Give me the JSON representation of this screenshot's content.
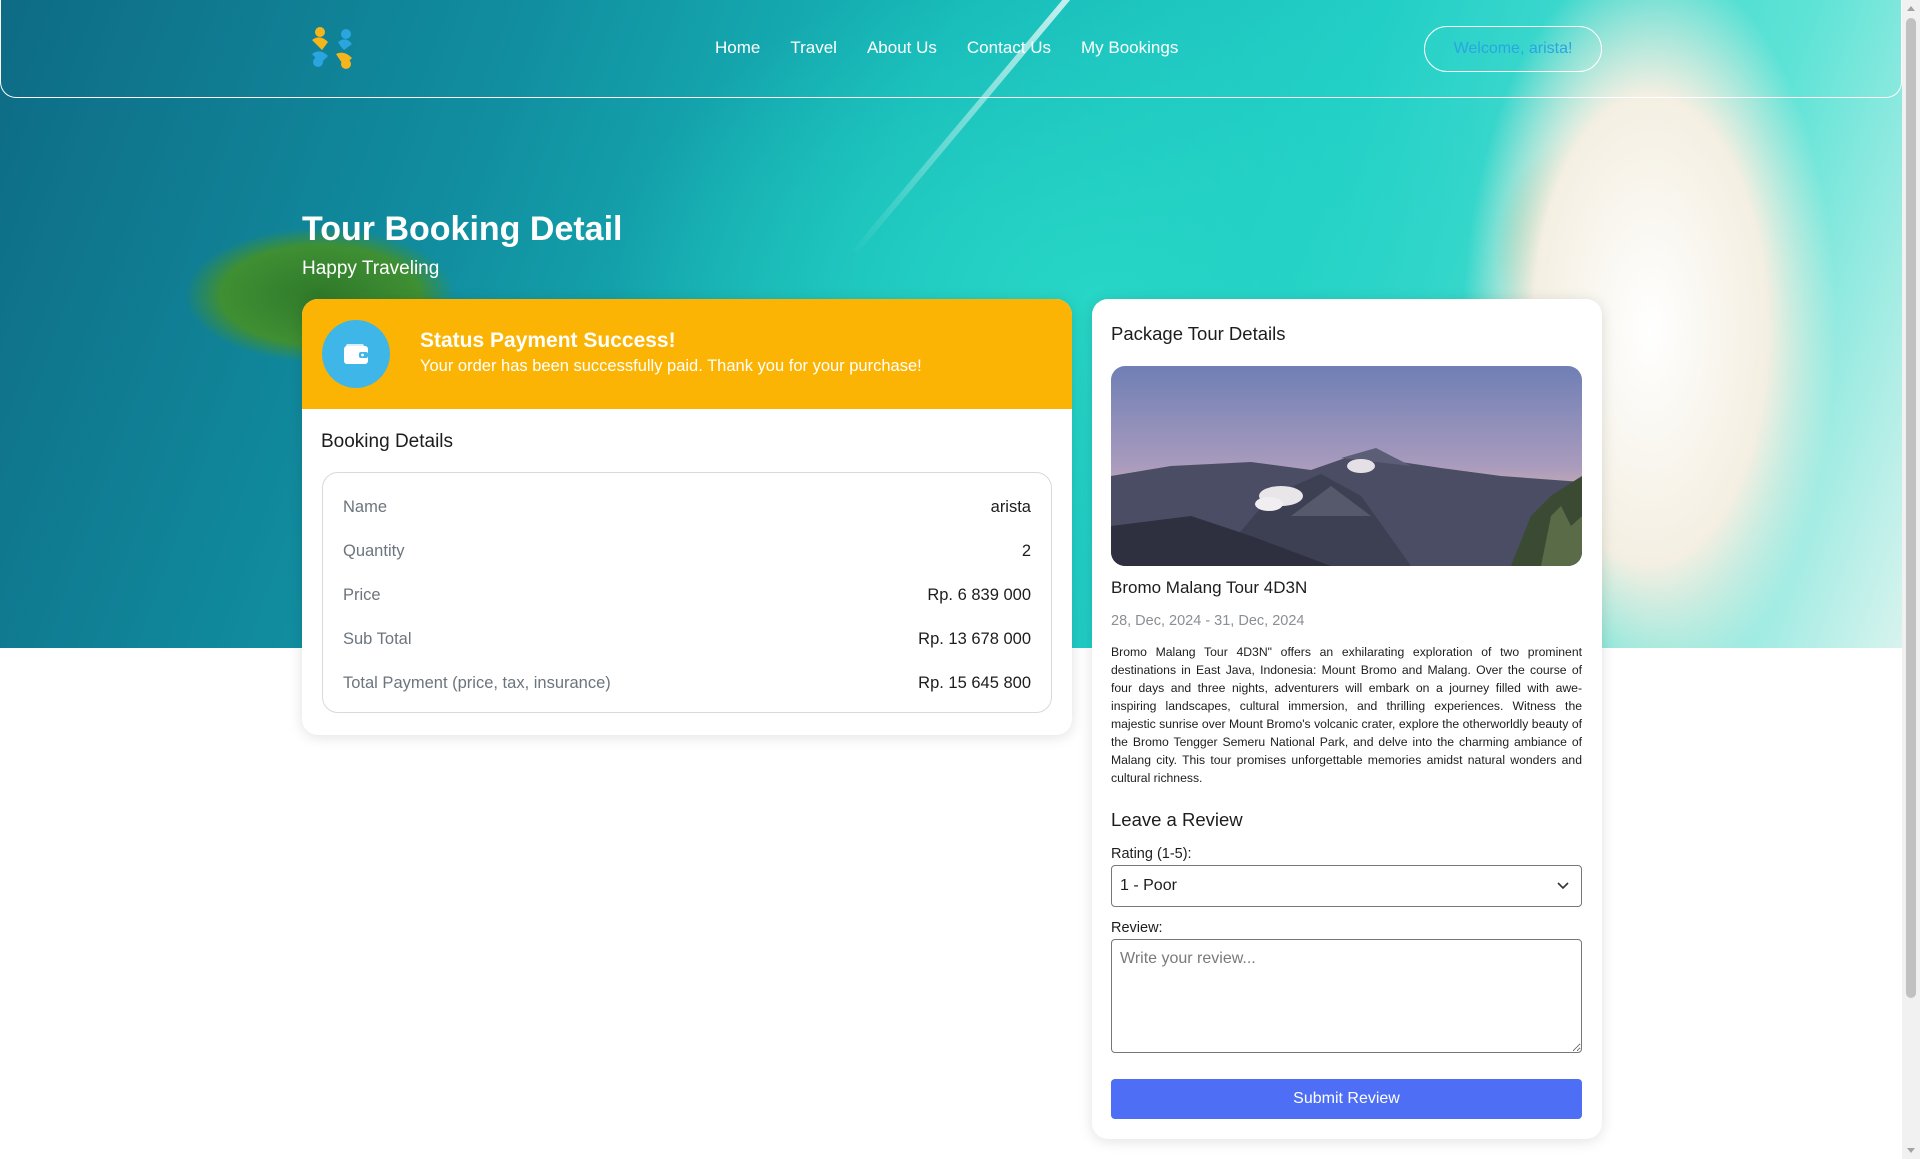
{
  "nav": {
    "logo": "logo-icon",
    "links": [
      "Home",
      "Travel",
      "About Us",
      "Contact Us",
      "My Bookings"
    ],
    "welcome": "Welcome, arista!"
  },
  "page": {
    "title": "Tour Booking Detail",
    "subtitle": "Happy Traveling"
  },
  "status": {
    "title": "Status Payment Success!",
    "message": "Your order has been successfully paid. Thank you for your purchase!",
    "icon": "wallet-icon"
  },
  "booking": {
    "heading": "Booking Details",
    "rows": [
      {
        "label": "Name",
        "value": "arista"
      },
      {
        "label": "Quantity",
        "value": "2"
      },
      {
        "label": "Price",
        "value": "Rp. 6 839 000"
      },
      {
        "label": "Sub Total",
        "value": "Rp. 13 678 000"
      },
      {
        "label": "Total Payment (price, tax, insurance)",
        "value": "Rp. 15 645 800"
      }
    ]
  },
  "package": {
    "heading": "Package Tour Details",
    "name": "Bromo Malang Tour 4D3N",
    "dates": "28, Dec, 2024 - 31, Dec, 2024",
    "description": "Bromo Malang Tour 4D3N\" offers an exhilarating exploration of two prominent destinations in East Java, Indonesia: Mount Bromo and Malang. Over the course of four days and three nights, adventurers will embark on a journey filled with awe-inspiring landscapes, cultural immersion, and thrilling experiences. Witness the majestic sunrise over Mount Bromo's volcanic crater, explore the otherworldly beauty of the Bromo Tengger Semeru National Park, and delve into the charming ambiance of Malang city. This tour promises unforgettable memories amidst natural wonders and cultural richness."
  },
  "review": {
    "heading": "Leave a Review",
    "rating_label": "Rating (1-5):",
    "rating_value": "1 - Poor",
    "review_label": "Review:",
    "placeholder": "Write your review...",
    "submit": "Submit Review"
  },
  "colors": {
    "status_banner": "#fcb404",
    "status_icon_bg": "#3fb6e8",
    "submit_button": "#4d6ef5"
  }
}
